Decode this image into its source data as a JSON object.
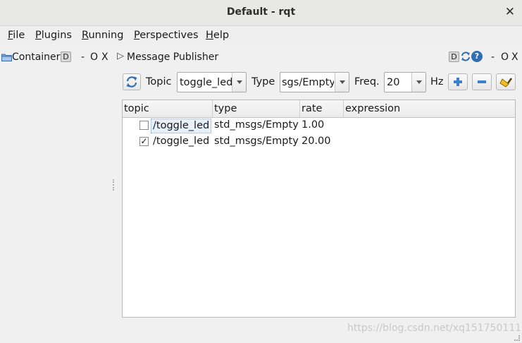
{
  "window": {
    "title": "Default - rqt",
    "close_glyph": "✕"
  },
  "menubar": {
    "items": [
      {
        "mnemonic": "F",
        "rest": "ile"
      },
      {
        "mnemonic": "P",
        "rest": "lugins"
      },
      {
        "mnemonic": "R",
        "rest": "unning"
      },
      {
        "mnemonic": "P",
        "rest": "erspectives"
      },
      {
        "mnemonic": "H",
        "rest": "elp"
      }
    ]
  },
  "container": {
    "label": "Container",
    "d_button": "D",
    "minimize": "-",
    "float": "O",
    "close": "X"
  },
  "plugin": {
    "title": "Message Publisher",
    "d_button": "D",
    "help": "?",
    "minimize": "-",
    "float": "O",
    "close": "X",
    "expand_glyph": "▷"
  },
  "toolbar": {
    "topic_label": "Topic",
    "topic_value": "toggle_led",
    "type_label": "Type",
    "type_value": "sgs/Empty",
    "freq_label": "Freq.",
    "freq_value": "20",
    "hz_label": "Hz",
    "icons": [
      "refresh-icon",
      "plus-icon",
      "minus-icon",
      "clean-broom-icon"
    ]
  },
  "table": {
    "headers": [
      "topic",
      "type",
      "rate",
      "expression"
    ],
    "rows": [
      {
        "checked": false,
        "check_glyph": "",
        "topic": "/toggle_led",
        "type": "std_msgs/Empty",
        "rate": "1.00",
        "expression": ""
      },
      {
        "checked": true,
        "check_glyph": "✓",
        "topic": "/toggle_led",
        "type": "std_msgs/Empty",
        "rate": "20.00",
        "expression": ""
      }
    ]
  },
  "watermark": "https://blog.csdn.net/xq151750111",
  "colors": {
    "accent_blue": "#2f6db5",
    "plus_blue": "#3a7fd0",
    "selection_bg": "#e8f0fb"
  }
}
